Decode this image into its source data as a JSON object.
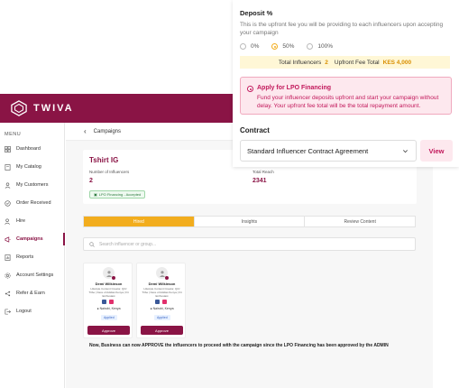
{
  "app": {
    "brand": "TWIVA",
    "menu_title": "MENU",
    "breadcrumb": "Campaigns"
  },
  "sidebar": {
    "items": [
      {
        "label": "Dashboard",
        "icon": "grid-icon"
      },
      {
        "label": "My Catalog",
        "icon": "catalog-icon"
      },
      {
        "label": "My Customers",
        "icon": "users-icon"
      },
      {
        "label": "Order Received",
        "icon": "order-icon"
      },
      {
        "label": "Hire",
        "icon": "hire-icon"
      },
      {
        "label": "Campaigns",
        "icon": "megaphone-icon",
        "active": true
      },
      {
        "label": "Reports",
        "icon": "reports-icon"
      },
      {
        "label": "Account Settings",
        "icon": "gear-icon"
      },
      {
        "label": "Refer & Earn",
        "icon": "share-icon"
      },
      {
        "label": "Logout",
        "icon": "logout-icon"
      }
    ]
  },
  "campaign": {
    "title": "Tshirt IG",
    "influencers_label": "Number of Influencers",
    "influencers_value": "2",
    "reach_label": "Total Reach",
    "reach_value": "2341",
    "status_chip": "LPO Financing - Accepted"
  },
  "tabs": [
    {
      "label": "Hired",
      "active": true
    },
    {
      "label": "Insights"
    },
    {
      "label": "Review Content"
    }
  ],
  "search": {
    "placeholder": "Search influencer or group..."
  },
  "influencers": [
    {
      "name": "Demi Wilkinson",
      "description": "Lifestyle Content Creator, Qrtz Tribe | Face of Adidas Kenya | Fit Enthusiast",
      "location": "Nairobi, Kenya",
      "status": "Applied",
      "action": "Approve"
    },
    {
      "name": "Demi Wilkinson",
      "description": "Lifestyle Content Creator, Qrtz Tribe | Face of Adidas Kenya | Fit Enthusiast",
      "location": "Nairobi, Kenya",
      "status": "Applied",
      "action": "Approve"
    }
  ],
  "note": "Now, Business can now APPROVE the influencers to proceed with the campaign since the LPO Financing has been approved by the ADMIN",
  "panel": {
    "deposit_title": "Deposit %",
    "deposit_desc": "This is the upfront fee you will be providing to each influencers upon accepting your campaign",
    "options": [
      {
        "label": "0%",
        "selected": false
      },
      {
        "label": "50%",
        "selected": true
      },
      {
        "label": "100%",
        "selected": false
      }
    ],
    "totals_label": "Total Influencers",
    "totals_count": "2",
    "upfront_label": "Upfront Fee Total",
    "upfront_value": "KES 4,000",
    "lpo_title": "Apply for LPO Financing",
    "lpo_desc": "Fund your influencer deposits upfront and start your campaign without delay. Your upfront fee total will be the total repayment amount.",
    "contract_label": "Contract",
    "contract_value": "Standard Influencer Contract Agreement",
    "view_button": "View"
  },
  "colors": {
    "brand": "#8a1445",
    "accent": "#f2ad1e",
    "lpo_pink": "#c2185b"
  }
}
